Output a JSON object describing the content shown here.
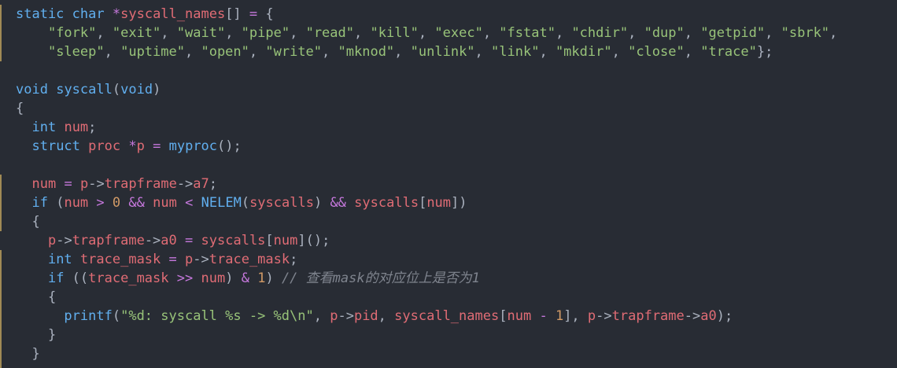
{
  "editor": {
    "language": "c",
    "code_lines": [
      "static char *syscall_names[] = {",
      "    \"fork\", \"exit\", \"wait\", \"pipe\", \"read\", \"kill\", \"exec\", \"fstat\", \"chdir\", \"dup\", \"getpid\", \"sbrk\",",
      "    \"sleep\", \"uptime\", \"open\", \"write\", \"mknod\", \"unlink\", \"link\", \"mkdir\", \"close\", \"trace\"};",
      "",
      "void syscall(void)",
      "{",
      "  int num;",
      "  struct proc *p = myproc();",
      "",
      "  num = p->trapframe->a7;",
      "  if (num > 0 && num < NELEM(syscalls) && syscalls[num])",
      "  {",
      "    p->trapframe->a0 = syscalls[num]();",
      "    int trace_mask = p->trace_mask;",
      "    if ((trace_mask >> num) & 1) // 查看mask的对应位上是否为1",
      "    {",
      "      printf(\"%d: syscall %s -> %d\\n\", p->pid, syscall_names[num - 1], p->trapframe->a0);",
      "    }",
      "  }"
    ]
  },
  "colors": {
    "background": "#282c34",
    "keyword": "#61afef",
    "identifier": "#e06c75",
    "string": "#98c379",
    "number": "#d19a66",
    "operator": "#c678dd",
    "comment": "#7f848e",
    "gutter_change_marker": "#a08a55"
  }
}
